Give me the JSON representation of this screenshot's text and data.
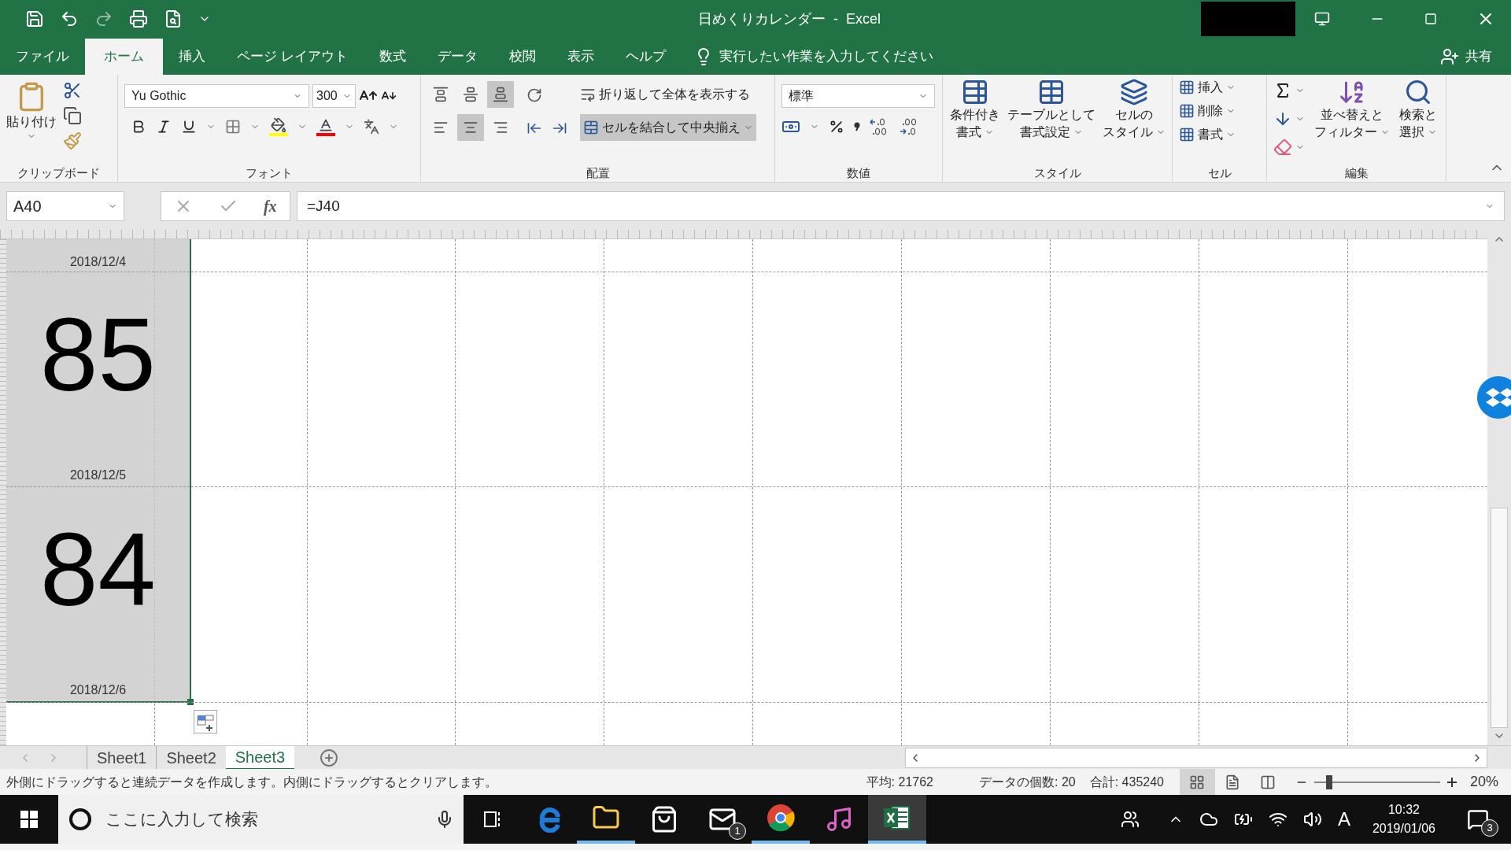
{
  "window": {
    "title": "日めくりカレンダー  -  Excel"
  },
  "menu_tabs": [
    {
      "label": "ファイル",
      "selected": false
    },
    {
      "label": "ホーム",
      "selected": true
    },
    {
      "label": "挿入",
      "selected": false
    },
    {
      "label": "ページ レイアウト",
      "selected": false
    },
    {
      "label": "数式",
      "selected": false
    },
    {
      "label": "データ",
      "selected": false
    },
    {
      "label": "校閲",
      "selected": false
    },
    {
      "label": "表示",
      "selected": false
    },
    {
      "label": "ヘルプ",
      "selected": false
    }
  ],
  "tell_me": "実行したい作業を入力してください",
  "share": "共有",
  "ribbon": {
    "clipboard": {
      "label": "クリップボード",
      "paste": "貼り付け"
    },
    "font": {
      "label": "フォント",
      "font_name": "Yu Gothic",
      "font_size": "300"
    },
    "alignment": {
      "label": "配置",
      "wrap": "折り返して全体を表示する",
      "merge": {
        "label": "セルを結合して中央揃え",
        "selected": true
      },
      "vertical": [
        {
          "selected": false
        },
        {
          "selected": false
        },
        {
          "selected": true
        }
      ],
      "horizontal": [
        {
          "selected": false
        },
        {
          "selected": true
        },
        {
          "selected": false
        }
      ]
    },
    "number": {
      "label": "数値",
      "format": "標準"
    },
    "styles": {
      "label": "スタイル",
      "buttons": [
        [
          "条件付き",
          "書式"
        ],
        [
          "テーブルとして",
          "書式設定"
        ],
        [
          "セルの",
          "スタイル"
        ]
      ]
    },
    "cells": {
      "label": "セル",
      "buttons": [
        "挿入",
        "削除",
        "書式"
      ]
    },
    "editing": {
      "label": "編集",
      "buttons": [
        [
          "並べ替えと",
          "フィルター"
        ],
        [
          "検索と",
          "選択"
        ]
      ]
    }
  },
  "formula_bar": {
    "name_box": "A40",
    "fx": "fx",
    "formula": "=J40"
  },
  "sheet": {
    "blocks": [
      {
        "date": "2018/12/4"
      },
      {
        "number": "85",
        "date": "2018/12/5"
      },
      {
        "number": "84",
        "date": "2018/12/6"
      }
    ]
  },
  "sheet_tabs": [
    {
      "label": "Sheet1",
      "selected": false
    },
    {
      "label": "Sheet2",
      "selected": false
    },
    {
      "label": "Sheet3",
      "selected": true
    }
  ],
  "status_bar": {
    "message": "外側にドラッグすると連続データを作成します。内側にドラッグするとクリアします。",
    "average": "平均: 21762",
    "count": "データの個数: 20",
    "sum": "合計: 435240",
    "views": [
      {
        "kind": "normal",
        "selected": true
      },
      {
        "kind": "layout",
        "selected": false
      },
      {
        "kind": "pagebreak",
        "selected": false
      }
    ],
    "zoom_slider": {
      "level": 0.12
    },
    "zoom": "20%"
  },
  "taskbar": {
    "search_placeholder": "ここに入力して検索",
    "mail_badge": "1",
    "ime": "A",
    "time": "10:32",
    "date": "2019/01/06",
    "notification_badge": "3"
  }
}
